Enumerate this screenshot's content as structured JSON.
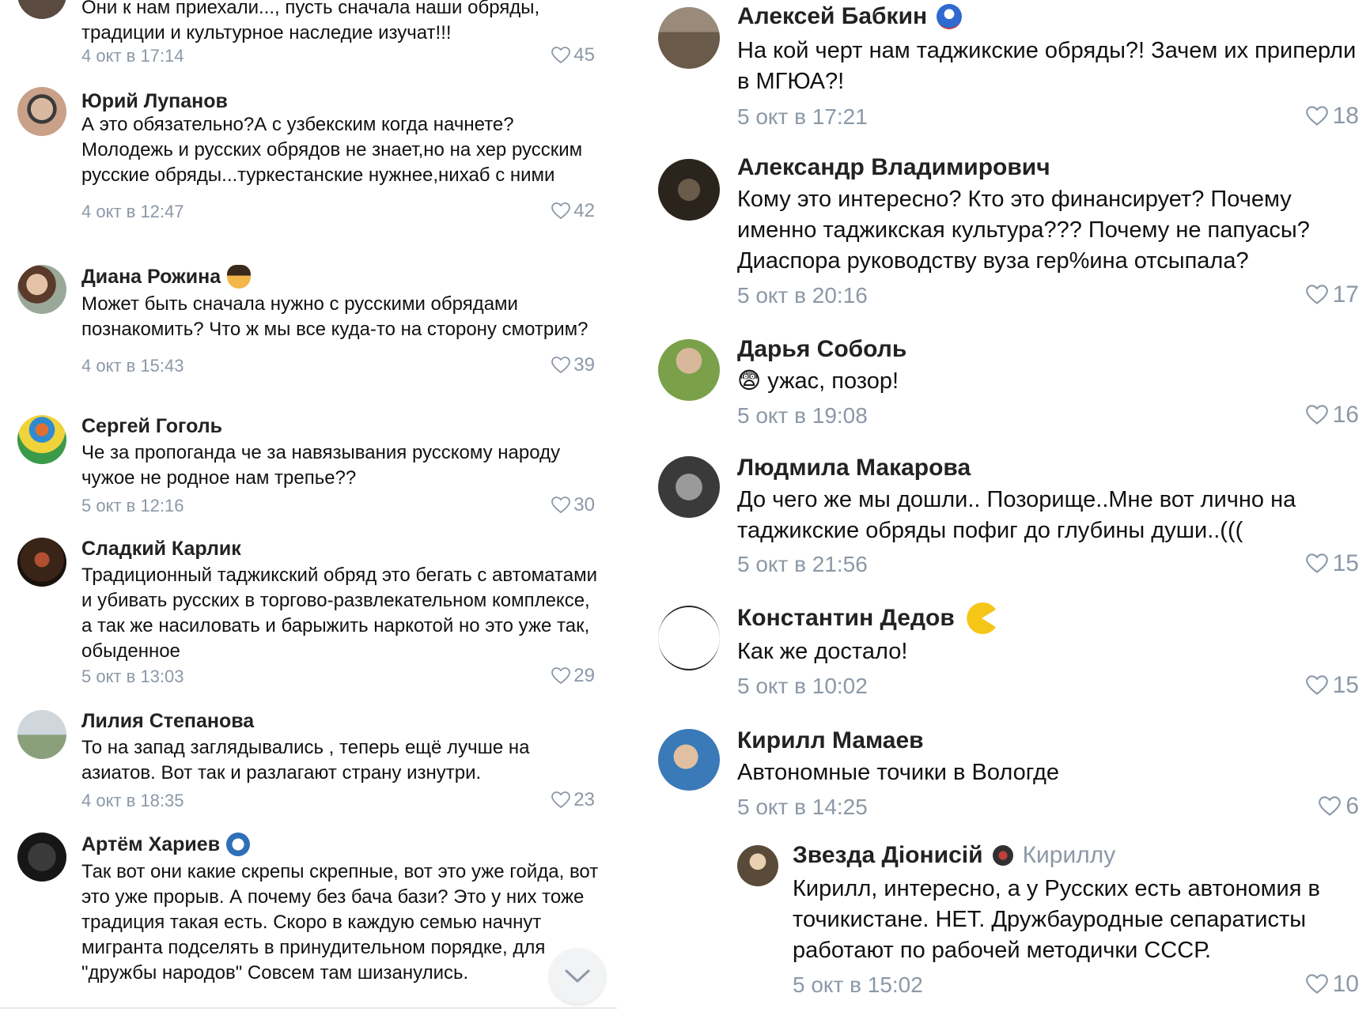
{
  "colors": {
    "meta": "#8c98a7",
    "text": "#111111",
    "name": "#222222"
  },
  "left_comments": [
    {
      "author": "",
      "text": "Они к нам приехали..., пусть сначала наши обряды, традиции и культурное наследие изучат!!!",
      "time": "4 окт в 17:14",
      "likes": "45"
    },
    {
      "author": "Юрий Лупанов",
      "text": "А это обязательно?А с узбекским когда начнете? Молодежь и русских обрядов не знает,но на хер русским русские обряды...туркестанские нужнее,нихаб с ними",
      "time": "4 окт в 12:47",
      "likes": "42"
    },
    {
      "author": "Диана Рожина",
      "text": "Может быть сначала нужно  с русскими  обрядами познакомить? Что ж мы все  куда-то на сторону смотрим?",
      "time": "4 окт в 15:43",
      "likes": "39"
    },
    {
      "author": "Сергей Гоголь",
      "text": "Че за пропоганда че за навязывания русскому народу чужое не родное нам трепье??",
      "time": "5 окт в 12:16",
      "likes": "30"
    },
    {
      "author": "Сладкий Карлик",
      "text": "Традиционный таджикский обряд это бегать с автоматами и убивать русских  в торгово-развлекательном комплексе, а так же насиловать и барыжить наркотой но это уже так, обыденное",
      "time": "5 окт в 13:03",
      "likes": "29"
    },
    {
      "author": "Лилия Степанова",
      "text": "То на запад заглядывались , теперь ещё лучше на азиатов. Вот так и разлагают страну изнутри.",
      "time": "4 окт в 18:35",
      "likes": "23"
    },
    {
      "author": "Артём Хариев",
      "text": "Так вот они какие скрепы скрепные, вот это уже гойда, вот это уже прорыв. А почему без бача бази? Это у них тоже традиция такая есть. Скоро в каждую семью начнут мигранта подселять в принудительном порядке, для \"дружбы народов\" Совсем там шизанулись.",
      "time": "",
      "likes": ""
    }
  ],
  "right_comments": [
    {
      "author": "Алексей Бабкин",
      "text": "На кой черт нам таджикские обряды?! Зачем их приперли в МГЮА?!",
      "time": "5 окт в 17:21",
      "likes": "18"
    },
    {
      "author": "Александр Владимирович",
      "text": "Кому это интересно? Кто это финансирует? Почему именно таджикская культура??? Почему не папуасы? Диаспора руководству вуза гер%ина отсыпала?",
      "time": "5 окт в 20:16",
      "likes": "17"
    },
    {
      "author": "Дарья Соболь",
      "text": "😨 ужас, позор!",
      "time": "5 окт в 19:08",
      "likes": "16"
    },
    {
      "author": "Людмила Макарова",
      "text": "До чего же мы дошли.. Позорище..Мне вот лично на таджикские обряды пофиг до глубины души..(((",
      "time": "5 окт в 21:56",
      "likes": "15"
    },
    {
      "author": "Константин Дедов",
      "text": "Как же достало!",
      "time": "5 окт в 10:02",
      "likes": "15"
    },
    {
      "author": "Кирилл Мамаев",
      "text": "Автономные точики в Вологде",
      "time": "5 окт в 14:25",
      "likes": "6"
    }
  ],
  "reply": {
    "author": "Звезда Діонисій",
    "reply_to": "Кириллу",
    "text": "Кирилл, интересно, а у Русских есть автономия в точикистане. НЕТ. Дружбауродные сепаратисты работают по рабочей методички СССР.",
    "time": "5 окт в 15:02",
    "likes": "10"
  },
  "icons": {
    "like": "heart-icon",
    "scroll": "chevron-down-icon"
  }
}
